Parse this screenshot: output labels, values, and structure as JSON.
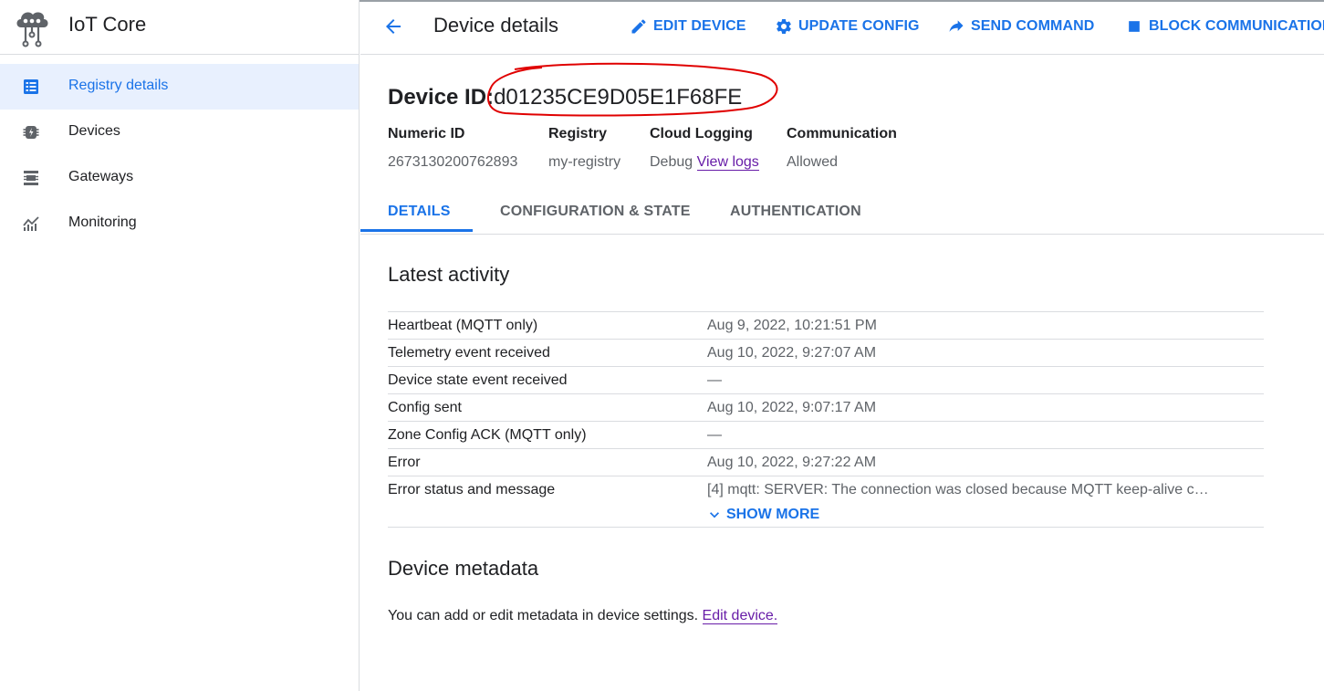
{
  "app": {
    "title": "IoT Core"
  },
  "sidebar": {
    "items": [
      {
        "label": "Registry details",
        "icon": "registry-icon",
        "active": true
      },
      {
        "label": "Devices",
        "icon": "devices-icon",
        "active": false
      },
      {
        "label": "Gateways",
        "icon": "gateways-icon",
        "active": false
      },
      {
        "label": "Monitoring",
        "icon": "monitoring-icon",
        "active": false
      }
    ]
  },
  "header": {
    "title": "Device details",
    "actions": [
      {
        "label": "EDIT DEVICE",
        "icon": "pencil-icon"
      },
      {
        "label": "UPDATE CONFIG",
        "icon": "gear-icon"
      },
      {
        "label": "SEND COMMAND",
        "icon": "forward-arrow-icon"
      },
      {
        "label": "BLOCK COMMUNICATION",
        "icon": "stop-square-icon"
      }
    ]
  },
  "device": {
    "id_label": "Device ID:",
    "id_value": "d01235CE9D05E1F68FE",
    "info": [
      {
        "label": "Numeric ID",
        "value": "2673130200762893"
      },
      {
        "label": "Registry",
        "value": "my-registry"
      },
      {
        "label": "Cloud Logging",
        "value": "Debug",
        "link": "View logs"
      },
      {
        "label": "Communication",
        "value": "Allowed"
      }
    ]
  },
  "tabs": [
    {
      "label": "DETAILS",
      "active": true
    },
    {
      "label": "CONFIGURATION & STATE",
      "active": false
    },
    {
      "label": "AUTHENTICATION",
      "active": false
    }
  ],
  "latest_activity": {
    "title": "Latest activity",
    "rows": [
      {
        "key": "Heartbeat (MQTT only)",
        "value": "Aug 9, 2022, 10:21:51 PM"
      },
      {
        "key": "Telemetry event received",
        "value": "Aug 10, 2022, 9:27:07 AM"
      },
      {
        "key": "Device state event received",
        "value": "—"
      },
      {
        "key": "Config sent",
        "value": "Aug 10, 2022, 9:07:17 AM"
      },
      {
        "key": "Zone Config ACK (MQTT only)",
        "value": "—"
      },
      {
        "key": "Error",
        "value": "Aug 10, 2022, 9:27:22 AM"
      },
      {
        "key": "Error status and message",
        "value": "[4] mqtt: SERVER: The connection was closed because MQTT keep-alive c…"
      }
    ],
    "show_more": "SHOW MORE"
  },
  "metadata": {
    "title": "Device metadata",
    "text": "You can add or edit metadata in device settings.",
    "link": "Edit device."
  },
  "colors": {
    "accent": "#1a73e8",
    "link_visited": "#681da8",
    "annotation": "#e00000",
    "active_nav_bg": "#e8f0fe"
  }
}
